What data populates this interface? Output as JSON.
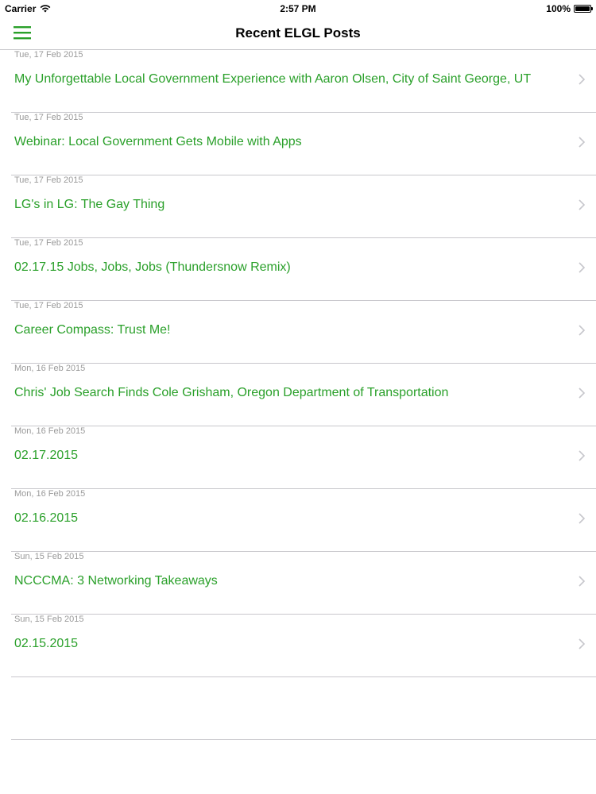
{
  "status_bar": {
    "carrier": "Carrier",
    "time": "2:57 PM",
    "battery": "100%"
  },
  "nav": {
    "title": "Recent ELGL Posts",
    "menu_icon": "hamburger-menu-icon"
  },
  "colors": {
    "accent": "#2aa02a",
    "date_gray": "#9a9a9a",
    "separator": "#c8c7cc",
    "chevron": "#c7c7cc"
  },
  "posts": [
    {
      "date": "Tue, 17 Feb 2015",
      "title": "My Unforgettable Local Government Experience with Aaron Olsen, City of Saint George, UT"
    },
    {
      "date": "Tue, 17 Feb 2015",
      "title": "Webinar: Local Government Gets Mobile with Apps"
    },
    {
      "date": "Tue, 17 Feb 2015",
      "title": "LG's in LG: The Gay Thing"
    },
    {
      "date": "Tue, 17 Feb 2015",
      "title": "02.17.15 Jobs, Jobs, Jobs (Thundersnow Remix)"
    },
    {
      "date": "Tue, 17 Feb 2015",
      "title": "Career Compass: Trust Me!"
    },
    {
      "date": "Mon, 16 Feb 2015",
      "title": "Chris' Job Search Finds Cole Grisham, Oregon Department of Transportation"
    },
    {
      "date": "Mon, 16 Feb 2015",
      "title": "02.17.2015"
    },
    {
      "date": "Mon, 16 Feb 2015",
      "title": "02.16.2015"
    },
    {
      "date": "Sun, 15 Feb 2015",
      "title": "NCCCMA: 3 Networking Takeaways"
    },
    {
      "date": "Sun, 15 Feb 2015",
      "title": "02.15.2015"
    }
  ]
}
